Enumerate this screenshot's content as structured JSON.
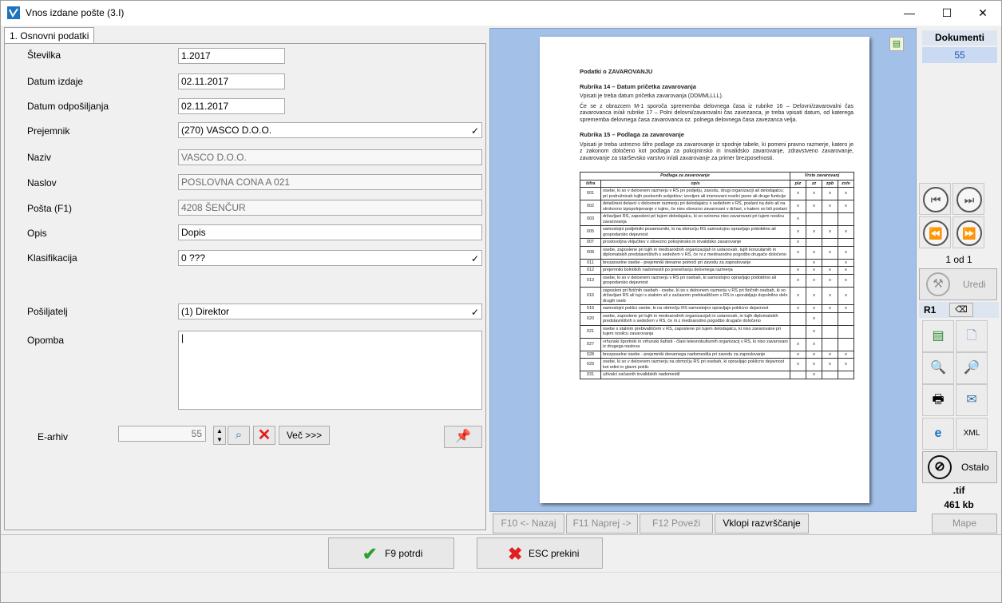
{
  "window": {
    "title": "Vnos izdane pošte  (3.I)",
    "minimize": "—",
    "maximize": "☐",
    "close": "✕"
  },
  "tab": {
    "label": "1. Osnovni podatki"
  },
  "form": {
    "stevilka": {
      "label": "Številka",
      "value": "1.2017"
    },
    "datum_izdaje": {
      "label": "Datum izdaje",
      "value": "02.11.2017"
    },
    "datum_odposiljanja": {
      "label": "Datum odpošiljanja",
      "value": "02.11.2017"
    },
    "prejemnik": {
      "label": "Prejemnik",
      "value": "(270) VASCO D.O.O."
    },
    "naziv": {
      "label": "Naziv",
      "value": "VASCO D.O.O."
    },
    "naslov": {
      "label": "Naslov",
      "value": "POSLOVNA CONA A 021"
    },
    "posta": {
      "label": "Pošta (F1)",
      "value": "4208 ŠENČUR"
    },
    "opis": {
      "label": "Opis",
      "value": "Dopis"
    },
    "klasifikacija": {
      "label": "Klasifikacija",
      "value": "0 ???"
    },
    "posiljatelj": {
      "label": "Pošiljatelj",
      "value": "(1) Direktor"
    },
    "opomba": {
      "label": "Opomba",
      "value": "|"
    },
    "earhiv": {
      "label": "E-arhiv",
      "value": "55",
      "vec_label": "Več >>>"
    }
  },
  "document": {
    "heading": "Podatki o ZAVAROVANJU",
    "r14_title": "Rubrika 14 – Datum pričetka zavarovanja",
    "r14_p1": "Vpisati je treba datum pričetka zavarovanja (DDMMLLLL).",
    "r14_p2": "Če se z obrazcem M-1 sporoča sprememba delovnega časa iz rubrike 16 – Delovni/zavarovalni čas zavarovanca in/ali rubrike 17 – Polni delovni/zavarovalni čas zavezanca, je treba vpisati datum, od katerega sprememba delovnega časa zavarovanca oz. polnega delovnega časa zavezanca velja.",
    "r15_title": "Rubrika 15 – Podlaga za zavarovanje",
    "r15_p1": "Vpisati je treba ustrezno šifro podlage za zavarovanje iz spodnje tabele, ki pomeni pravno razmerje, katero je z zakonom določeno kot podlaga za pokojninsko in invalidsko zavarovanje, zdravstveno zavarovanje, zavarovanje za starševsko varstvo in/ali zavarovanje za primer brezposelnosti.",
    "table_head1": "Podlaga za zavarovanje",
    "table_head2": "Vrste zavarovanj",
    "col_sifra": "šifra",
    "col_opis": "opis",
    "col_piz": "piz",
    "col_zz": "zz",
    "col_zpb": "zpb",
    "col_zstv": "zstv",
    "rows": [
      {
        "sifra": "001",
        "opis": "osebe, ki so v delovnem razmerju v RS pri podjetju, zavodu, drugi organizaciji ali delodajalcu; pri podružnicah tujih poslovnih subjektov; izvoljeni ali imenovani nosilci javne ali druge funkcije",
        "piz": "x",
        "zz": "x",
        "zpb": "x",
        "zstv": "x"
      },
      {
        "sifra": "002",
        "opis": "detaširani delavci v delovnem razmerju pri delodajalcu s sedežem v RS, poslani na delo ali na strokovno izpopolnjevanje v tujino, če niso obvezno zavarovani v državi, v katero so bili poslani",
        "piz": "x",
        "zz": "x",
        "zpb": "x",
        "zstv": "x"
      },
      {
        "sifra": "003",
        "opis": "državljani RS, zaposleni pri tujem delodajalcu, ki so oziroma niso zavarovani pri tujem nosilcu zavarovanja",
        "piz": "x",
        "zz": "",
        "zpb": "",
        "zstv": ""
      },
      {
        "sifra": "005",
        "opis": "samostojni podjetniki posamezniki, ki na območju RS samostojno opravljajo pridobitno ali gospodarsko dejavnost",
        "piz": "x",
        "zz": "x",
        "zpb": "x",
        "zstv": "x"
      },
      {
        "sifra": "007",
        "opis": "prostovoljna vključitev v obvezno pokojninsko in invalidsko zavarovanje",
        "piz": "x",
        "zz": "",
        "zpb": "",
        "zstv": ""
      },
      {
        "sifra": "008",
        "opis": "osebe, zaposlene pri tujih in mednarodnih organizacijah in ustanovah, tujih konzularnih in diplomatskih predstavništvih s sedežem v RS, če ni z mednarodno pogodbo drugače določeno",
        "piz": "x",
        "zz": "x",
        "zpb": "x",
        "zstv": "x"
      },
      {
        "sifra": "011",
        "opis": "brezposelne osebe - prejemniki denarne pomoči pri zavodu za zaposlovanje",
        "piz": "",
        "zz": "x",
        "zpb": "",
        "zstv": "x"
      },
      {
        "sifra": "012",
        "opis": "prejemniki bolniških nadomestil po prenehanju delovnega razmerja",
        "piz": "x",
        "zz": "x",
        "zpb": "x",
        "zstv": "x"
      },
      {
        "sifra": "013",
        "opis": "osebe, ki so v delovnem razmerju v RS pri osebah, ki samostojno opravljajo pridobitno ali gospodarsko dejavnost",
        "piz": "x",
        "zz": "x",
        "zpb": "x",
        "zstv": "x"
      },
      {
        "sifra": "016",
        "opis": "zaposleni pri fizičnih osebah - osebe, ki so v delovnem razmerju v RS pri fizičnih osebah, ki so državljani RS ali tujci s stalnim ali z začasnim prebivališčem v RS in uporabljajo dopolnilno delo drugih oseb",
        "piz": "x",
        "zz": "x",
        "zpb": "x",
        "zstv": "x"
      },
      {
        "sifra": "019",
        "opis": "samostojni poklici osebe, ki na območju RS samostojno opravljajo poklicno dejavnost",
        "piz": "x",
        "zz": "x",
        "zpb": "x",
        "zstv": "x"
      },
      {
        "sifra": "020",
        "opis": "osebe, zaposlene pri tujih in mednarodnih organizacijah in ustanovah, in tujih diplomatskih predstavništvih s sedežem v RS, če ni z mednarodno pogodbo drugače določeno",
        "piz": "",
        "zz": "x",
        "zpb": "",
        "zstv": ""
      },
      {
        "sifra": "021",
        "opis": "osebe s stalnim prebivališčem v RS, zaposlene pri tujem delodajalcu, ki niso zavarovane pri tujem nosilcu zavarovanja",
        "piz": "",
        "zz": "x",
        "zpb": "",
        "zstv": ""
      },
      {
        "sifra": "027",
        "opis": "vrhunski športniki in vrhunski šahisti - člani telesnokulturnih organizacij v RS, ki niso zavarovani iz drugega naslova",
        "piz": "x",
        "zz": "x",
        "zpb": "",
        "zstv": ""
      },
      {
        "sifra": "028",
        "opis": "brezposelne osebe - prejemniki denarnega nadomestila pri zavodu za zaposlovanje",
        "piz": "x",
        "zz": "x",
        "zpb": "x",
        "zstv": "x"
      },
      {
        "sifra": "029",
        "opis": "osebe, ki so v delovnem razmerju na območju RS pri osebah, ki opravljajo poklicno dejavnost kot edini in glavni poklic",
        "piz": "x",
        "zz": "x",
        "zpb": "x",
        "zstv": "x"
      },
      {
        "sifra": "031",
        "opis": "uživalci začasnih invalidskih nadomestil",
        "piz": "",
        "zz": "x",
        "zpb": "",
        "zstv": ""
      }
    ]
  },
  "docnav": {
    "nazaj": "F10 <- Nazaj",
    "naprej": "F11 Naprej ->",
    "povezi": "F12 Poveži",
    "razvrscanje": "Vklopi razvrščanje"
  },
  "side": {
    "dokumenti_label": "Dokumenti",
    "dokumenti_count": "55",
    "page_info": "1 od 1",
    "uredi": "Uredi",
    "r1": "R1",
    "ostalo": "Ostalo",
    "ext": ".tif",
    "size": "461 kb",
    "mape": "Mape"
  },
  "footer": {
    "potrdi": "F9 potrdi",
    "prekini": "ESC prekini"
  },
  "colors": {
    "accent": "#1e73be",
    "docbg": "#a3c0e8",
    "ok": "#2ca02c",
    "cancel": "#e02020"
  }
}
